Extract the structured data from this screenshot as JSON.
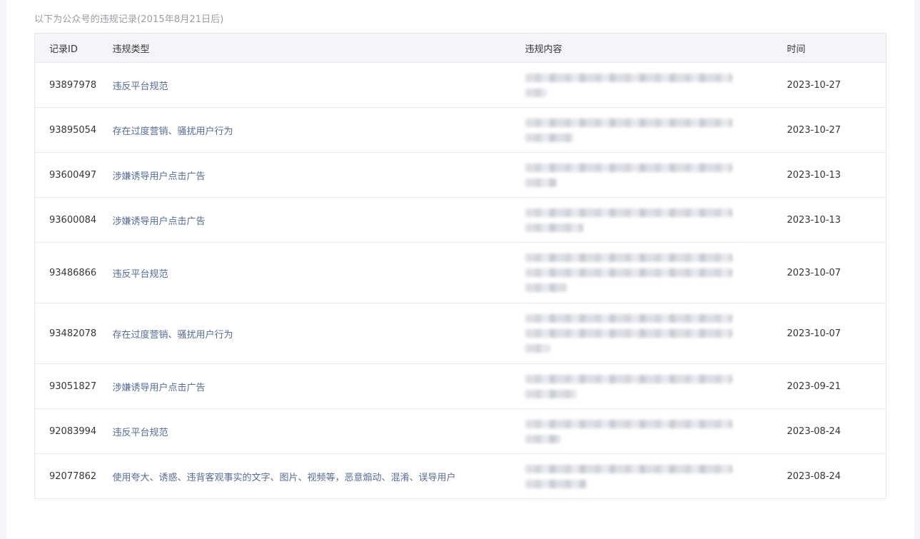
{
  "notice": "以下为公众号的违规记录(2015年8月21日后)",
  "table": {
    "headers": {
      "id": "记录ID",
      "type": "违规类型",
      "content": "违规内容",
      "time": "时间"
    },
    "rows": [
      {
        "id": "93897978",
        "type": "违反平台规范",
        "time": "2023-10-27",
        "content_lines": 2
      },
      {
        "id": "93895054",
        "type": "存在过度营销、骚扰用户行为",
        "time": "2023-10-27",
        "content_lines": 2
      },
      {
        "id": "93600497",
        "type": "涉嫌诱导用户点击广告",
        "time": "2023-10-13",
        "content_lines": 2
      },
      {
        "id": "93600084",
        "type": "涉嫌诱导用户点击广告",
        "time": "2023-10-13",
        "content_lines": 2
      },
      {
        "id": "93486866",
        "type": "违反平台规范",
        "time": "2023-10-07",
        "content_lines": 3
      },
      {
        "id": "93482078",
        "type": "存在过度营销、骚扰用户行为",
        "time": "2023-10-07",
        "content_lines": 3
      },
      {
        "id": "93051827",
        "type": "涉嫌诱导用户点击广告",
        "time": "2023-09-21",
        "content_lines": 2
      },
      {
        "id": "92083994",
        "type": "违反平台规范",
        "time": "2023-08-24",
        "content_lines": 2
      },
      {
        "id": "92077862",
        "type": "使用夸大、诱惑、违背客观事实的文字、图片、视频等，恶意煽动、混淆、误导用户",
        "time": "2023-08-24",
        "content_lines": 2
      }
    ]
  }
}
